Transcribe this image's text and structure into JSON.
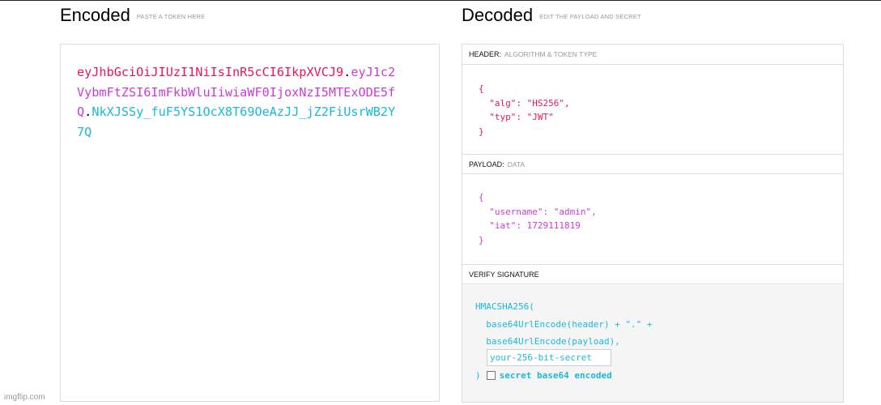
{
  "encoded": {
    "title": "Encoded",
    "hint": "PASTE A TOKEN HERE",
    "token": {
      "header": "eyJhbGciOiJIUzI1NiIsInR5cCI6IkpXVCJ9",
      "dot1": ".",
      "payload": "eyJ1c2VybmFtZSI6ImFkbWluIiwiaWF0IjoxNzI5MTExODE5fQ",
      "dot2": ".",
      "signature": "NkXJSSy_fuF5YS1OcX8T69OeAzJJ_jZ2FiUsrWB2Y7Q"
    }
  },
  "decoded": {
    "title": "Decoded",
    "hint": "EDIT THE PAYLOAD AND SECRET",
    "header": {
      "label": "HEADER:",
      "sub": "ALGORITHM & TOKEN TYPE",
      "code": "{\n  \"alg\": \"HS256\",\n  \"typ\": \"JWT\"\n}"
    },
    "payload": {
      "label": "PAYLOAD:",
      "sub": "DATA",
      "code": "{\n  \"username\": \"admin\",\n  \"iat\": 1729111819\n}"
    },
    "verify": {
      "label": "VERIFY SIGNATURE",
      "code": "HMACSHA256(\n  base64UrlEncode(header) + \".\" +\n  base64UrlEncode(payload),",
      "secret_placeholder": "your-256-bit-secret",
      "close_paren": ")",
      "b64_label": "secret base64 encoded"
    }
  },
  "watermark": "imgflip.com",
  "colors": {
    "header": "#e8175d",
    "payload": "#c93dd6",
    "signature": "#1ab9dc"
  }
}
